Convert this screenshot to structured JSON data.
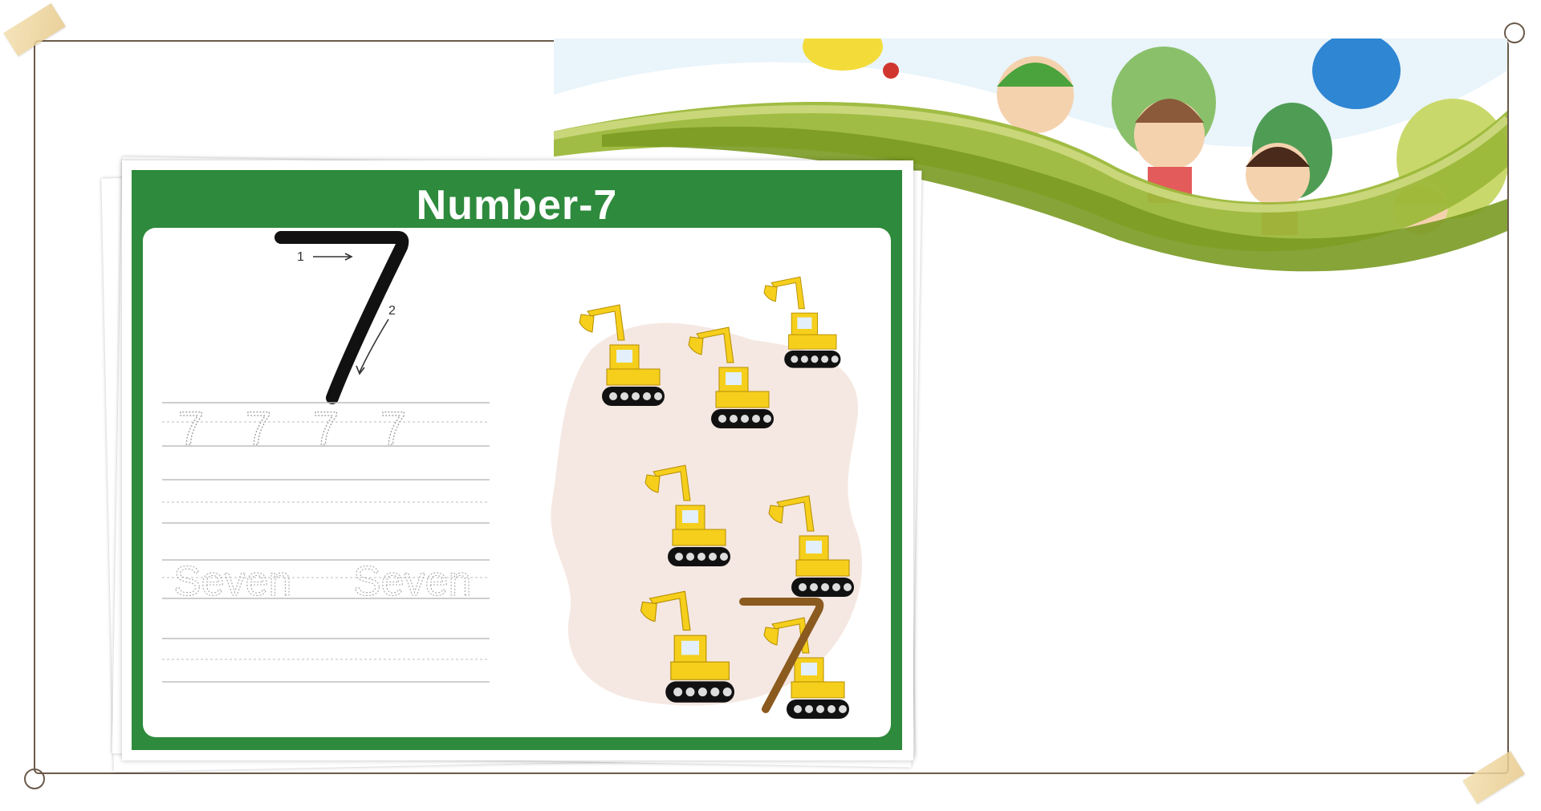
{
  "worksheet": {
    "title": "Number-7",
    "stroke_labels": [
      "1",
      "2"
    ],
    "trace_digits": [
      "7",
      "7",
      "7",
      "7"
    ],
    "trace_words": [
      "Seven",
      "Seven"
    ]
  },
  "colors": {
    "worksheet_border": "#2e8a3c",
    "excavator_yellow": "#f5cf1c",
    "big_seven_stroke": "#111111",
    "brown_seven": "#8b5a1e",
    "frame_line": "#6b5a4a"
  },
  "excavator_count": 7
}
